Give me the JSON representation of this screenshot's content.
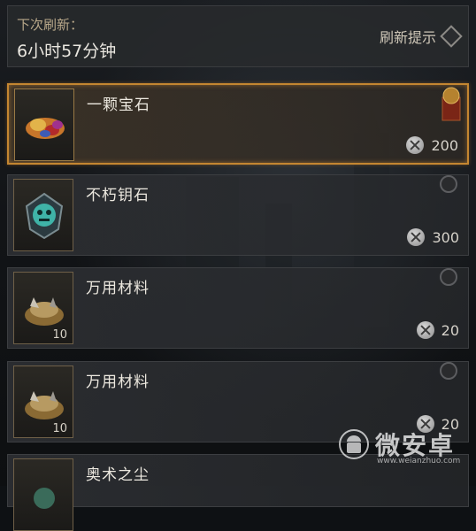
{
  "header": {
    "next_refresh_label": "下次刷新：",
    "time_remaining": "6小时57分钟",
    "refresh_reminder_label": "刷新提示"
  },
  "items": [
    {
      "name": "一颗宝石",
      "price": "200",
      "quantity": "",
      "icon": "gem-icon",
      "selected": true
    },
    {
      "name": "不朽钥石",
      "price": "300",
      "quantity": "",
      "icon": "keystone-icon",
      "selected": false
    },
    {
      "name": "万用材料",
      "price": "20",
      "quantity": "10",
      "icon": "material-icon",
      "selected": false
    },
    {
      "name": "万用材料",
      "price": "20",
      "quantity": "10",
      "icon": "material-icon",
      "selected": false
    },
    {
      "name": "奥术之尘",
      "price": "",
      "quantity": "",
      "icon": "arcane-dust-icon",
      "selected": false
    }
  ],
  "watermark": {
    "text": "微安卓",
    "url": "www.weianzhuo.com"
  },
  "colors": {
    "accent": "#c48631",
    "text": "#ece8df",
    "label": "#b9a88a"
  }
}
